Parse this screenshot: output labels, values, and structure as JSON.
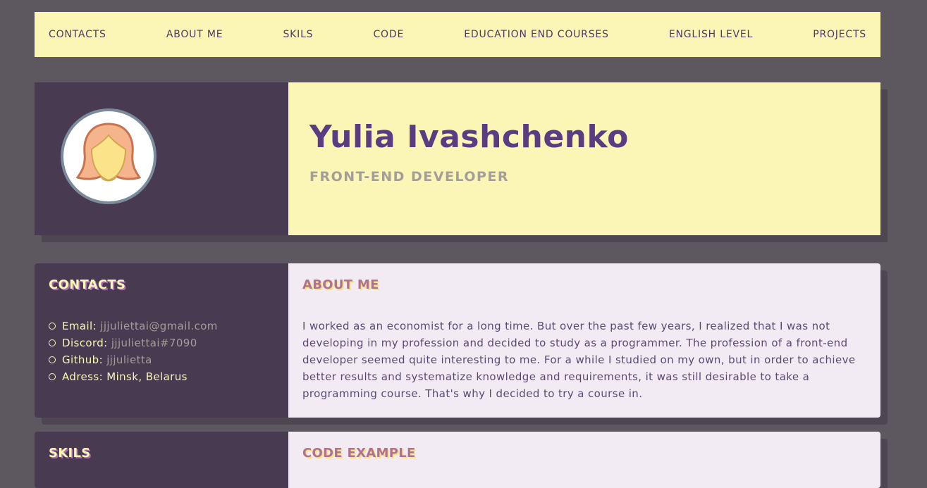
{
  "nav": {
    "items": [
      "CONTACTS",
      "ABOUT ME",
      "SKILS",
      "CODE",
      "EDUCATION END COURSES",
      "ENGLISH LEVEL",
      "PROJECTS"
    ]
  },
  "hero": {
    "avatar_icon": "woman-avatar-icon",
    "name": "Yulia Ivashchenko",
    "role": "FRONT-END DEVELOPER"
  },
  "contacts": {
    "title": "CONTACTS",
    "items": [
      {
        "label": "Email:",
        "value": "jjjuliettai@gmail.com"
      },
      {
        "label": "Discord:",
        "value": "jjjuliettai#7090"
      },
      {
        "label": "Github:",
        "value": "jjjulietta"
      },
      {
        "label": "Adress: Minsk, Belarus",
        "value": ""
      }
    ]
  },
  "about": {
    "title": "ABOUT ME",
    "text": "I worked as an economist for a long time. But over the past few years, I realized that I was not developing in my profession and decided to study as a programmer. The profession of a front-end developer seemed quite interesting to me. For a while I studied on my own, but in order to achieve better results and systematize knowledge and requirements, it was still desirable to take a programming course. That's why I decided to try a course in."
  },
  "skills": {
    "title": "SKILS"
  },
  "code": {
    "title": "CODE EXAMPLE"
  },
  "colors": {
    "background": "#5d5860",
    "accent_yellow": "#fbf5b6",
    "dark_panel": "#473a51",
    "light_panel": "#f3ebf4",
    "name_purple": "#5a3c83"
  }
}
